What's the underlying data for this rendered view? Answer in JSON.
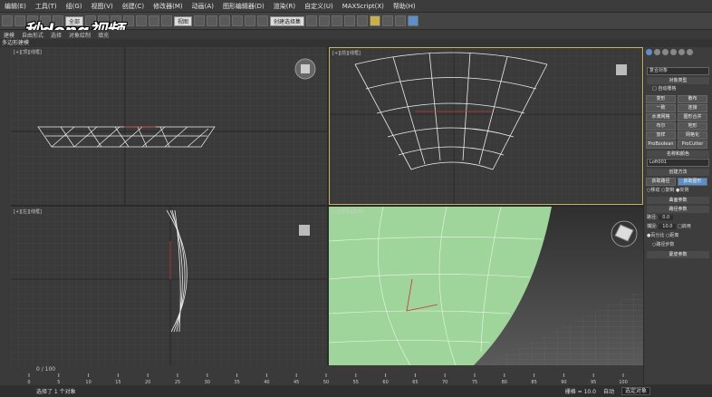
{
  "menu": [
    "编辑(E)",
    "工具(T)",
    "组(G)",
    "视图(V)",
    "创建(C)",
    "修改器(M)",
    "动画(A)",
    "图形编辑器(D)",
    "渲染(R)",
    "自定义(U)",
    "MAXScript(X)",
    "帮助(H)"
  ],
  "toolbar": {
    "filter": "全部",
    "view": "视图",
    "selection_set": "创建选择集"
  },
  "watermark": "秒dong视频",
  "ribbon": [
    "建模",
    "自由形式",
    "选择",
    "对象绘制",
    "填充"
  ],
  "modeling_label": "多边形建模",
  "viewports": [
    {
      "name": "top-left",
      "label": "[+][顶][线框]"
    },
    {
      "name": "top-right",
      "label": "[+][前][线框]"
    },
    {
      "name": "bottom-left",
      "label": "[+][左][线框]"
    },
    {
      "name": "bottom-right",
      "label": "[+][透视][真实]"
    }
  ],
  "panel": {
    "dropdown": "复合对象",
    "object_type_header": "对象类型",
    "autogrid": "自动栅格",
    "buttons": [
      "变形",
      "散布",
      "一致",
      "连接",
      "水滴网格",
      "图形合并",
      "布尔",
      "地形",
      "放样",
      "网格化",
      "ProBoolean",
      "ProCutter"
    ],
    "name_color_header": "名称和颜色",
    "object_name": "Loft001",
    "creation_method_header": "创建方法",
    "get_path": "获取路径",
    "get_shape": "获取图形",
    "move": "移动",
    "copy": "复制",
    "instance": "实例",
    "surface_params": "曲面参数",
    "path_params_header": "路径参数",
    "path_label": "路径:",
    "path_value": "0.0",
    "snap_label": "捕捉:",
    "snap_value": "10.0",
    "enable": "启用",
    "percent": "百分比",
    "distance": "距离",
    "path_steps": "路径步数",
    "skin_params": "蒙皮参数"
  },
  "timeline": {
    "frame": "0 / 100",
    "ticks": [
      "0",
      "5",
      "10",
      "15",
      "20",
      "25",
      "30",
      "35",
      "40",
      "45",
      "50",
      "55",
      "60",
      "65",
      "70",
      "75",
      "80",
      "85",
      "90",
      "95",
      "100"
    ]
  },
  "status": {
    "message": "选择了 1 个对象",
    "grid": "栅格 = 10.0",
    "auto": "自动",
    "selection": "选定对象"
  },
  "colors": {
    "viewport_bg": "#3a3a3a",
    "perspective_surface": "#9fd59a",
    "accent": "#5b8fc7"
  }
}
